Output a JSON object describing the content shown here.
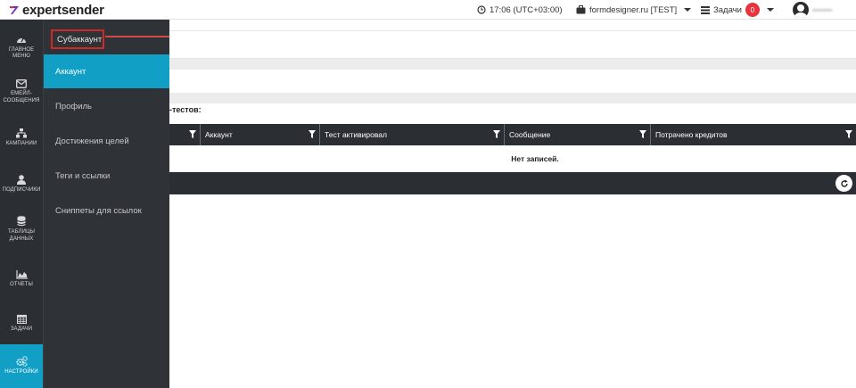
{
  "header": {
    "logo_text": "expertsender",
    "time": "17:06 (UTC+03:00)",
    "account": "formdesigner.ru [TEST]",
    "tasks_label": "Задачи",
    "tasks_count": "0",
    "username": "••••••••"
  },
  "sidebar": {
    "items": [
      {
        "label": "ГЛАВНОЕ МЕНЮ",
        "icon": "dashboard-icon"
      },
      {
        "label": "ЕМЕЙЛ-СООБЩЕНИЯ",
        "icon": "envelope-icon"
      },
      {
        "label": "КАМПАНИИ",
        "icon": "sitemap-icon"
      },
      {
        "label": "ПОДПИСЧИКИ",
        "icon": "user-icon"
      },
      {
        "label": "ТАБЛИЦЫ ДАННЫХ",
        "icon": "database-icon"
      },
      {
        "label": "ОТЧЕТЫ",
        "icon": "area-chart-icon"
      },
      {
        "label": "ЗАДАЧИ",
        "icon": "calendar-icon"
      },
      {
        "label": "НАСТРОЙКИ",
        "icon": "cogs-icon"
      }
    ]
  },
  "flyout": {
    "items": [
      {
        "label": "Субаккаунт"
      },
      {
        "label": "Аккаунт"
      },
      {
        "label": "Профиль"
      },
      {
        "label": "Достижения целей"
      },
      {
        "label": "Теги и ссылки"
      },
      {
        "label": "Сниппеты для ссылок"
      }
    ]
  },
  "main": {
    "section_title": "-тестов:",
    "columns": [
      "Аккаунт",
      "Тест активировал",
      "Сообщение",
      "Потрачено кредитов"
    ],
    "empty_text": "Нет записей."
  },
  "colors": {
    "accent": "#129fc6",
    "sidebar_bg": "#2b2e33",
    "highlight_box": "#cc2a26",
    "badge": "#e8343d"
  }
}
